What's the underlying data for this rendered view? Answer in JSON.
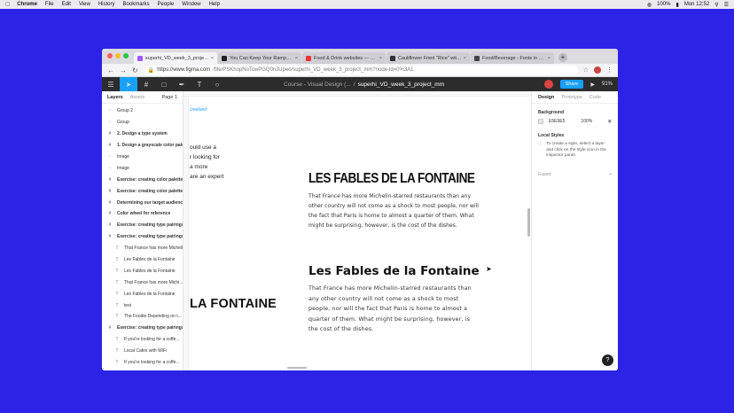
{
  "menubar": {
    "apple": "",
    "items": [
      "Chrome",
      "File",
      "Edit",
      "View",
      "History",
      "Bookmarks",
      "People",
      "Window",
      "Help"
    ],
    "battery": "100%",
    "clock": "Mon 12:52"
  },
  "browser": {
    "tabs": [
      {
        "title": "superhi_VD_week_3_project_mm",
        "color": "#a259ff",
        "active": true
      },
      {
        "title": "You Can Keep Your Ramps, Fr...",
        "color": "#222222",
        "active": false
      },
      {
        "title": "Food & Drink websites — alsc",
        "color": "#e33333",
        "active": false
      },
      {
        "title": "Cauliflower Fried \"Rice\" with C",
        "color": "#333333",
        "active": false
      },
      {
        "title": "Food/Beverage - Fonts in Use",
        "color": "#444444",
        "active": false
      }
    ],
    "new_tab": "+",
    "url_host": "https://www.figma.com",
    "url_path": "/file/PSKhopNoTcwPGQ0nJUpeo/superhi_VD_week_3_project_mm?node-id=0%3A1"
  },
  "figma": {
    "doc_parent": "Course - Visual Design (...",
    "doc_sep": "/",
    "doc_name": "superhi_VD_week_3_project_mm",
    "share_label": "Share",
    "zoom": "91%",
    "panels": {
      "layers_tab": "Layers",
      "assets_tab": "Assets",
      "page": "Page 1",
      "design_tab": "Design",
      "prototype_tab": "Prototype",
      "code_tab": "Code"
    },
    "layers": [
      {
        "label": "Group 2",
        "icon": "▫",
        "bold": false,
        "indent": 0
      },
      {
        "label": "Group",
        "icon": "▫",
        "bold": false,
        "indent": 0
      },
      {
        "label": "2. Design a type system",
        "icon": "#",
        "bold": true,
        "indent": 0
      },
      {
        "label": "1. Design a grayscale color pale...",
        "icon": "#",
        "bold": true,
        "indent": 0
      },
      {
        "label": "Image",
        "icon": "▫",
        "bold": false,
        "indent": 0
      },
      {
        "label": "Image",
        "icon": "▫",
        "bold": false,
        "indent": 0
      },
      {
        "label": "Exercise: creating color palettes",
        "icon": "#",
        "bold": true,
        "indent": 0
      },
      {
        "label": "Exercise: creating color palettes",
        "icon": "#",
        "bold": true,
        "indent": 0
      },
      {
        "label": "Determining our target audience",
        "icon": "#",
        "bold": true,
        "indent": 0
      },
      {
        "label": "Color wheel for reference",
        "icon": "#",
        "bold": true,
        "indent": 0
      },
      {
        "label": "Exercise: creating type pairings",
        "icon": "#",
        "bold": true,
        "indent": 0
      },
      {
        "label": "Exercise: creating type pairings",
        "icon": "#",
        "bold": true,
        "indent": 0
      },
      {
        "label": "That France has more Michelin...",
        "icon": "T",
        "bold": false,
        "indent": 1
      },
      {
        "label": "Les Fables de la Fontaine",
        "icon": "T",
        "bold": false,
        "indent": 1
      },
      {
        "label": "Les Fables de la Fontaine",
        "icon": "T",
        "bold": false,
        "indent": 1
      },
      {
        "label": "That France has more Michi...",
        "icon": "T",
        "bold": false,
        "indent": 1
      },
      {
        "label": "Les Fables de la Fontaine",
        "icon": "T",
        "bold": false,
        "indent": 1
      },
      {
        "label": "text",
        "icon": "T",
        "bold": false,
        "indent": 1
      },
      {
        "label": "The Foodie Depending on t...",
        "icon": "T",
        "bold": false,
        "indent": 1
      },
      {
        "label": "Exercise: creating type pairings",
        "icon": "#",
        "bold": true,
        "indent": 0
      },
      {
        "label": "If you're looking for a coffe...",
        "icon": "T",
        "bold": false,
        "indent": 1
      },
      {
        "label": "Local Cafes with WiFi",
        "icon": "T",
        "bold": false,
        "indent": 1
      },
      {
        "label": "If you're looking for a coffe...",
        "icon": "T",
        "bold": false,
        "indent": 1
      }
    ],
    "design_panel": {
      "background_title": "Background",
      "bg_color": "E5E5E5",
      "bg_opacity": "100%",
      "local_styles_title": "Local Styles",
      "local_styles_hint": "To create a style, select a layer and click on the style icon in the inspector panel.",
      "export_title": "Export",
      "export_add": "+"
    },
    "canvas": {
      "frame_label": "creeland",
      "fragment_lines": [
        "ould use a",
        "r looking for",
        "a more",
        " are an expert"
      ],
      "big_fragment": "LA FONTAINE",
      "heading1": "LES FABLES DE LA FONTAINE",
      "paragraph1": "That France has more Michelin-starred restaurants than any other country will not come as a shock to most people, nor will the fact that Paris is home to almost a quarter of them. What might be surprising, however, is the cost of the dishes.",
      "heading2": "Les Fables de la Fontaine",
      "paragraph2": "That France has more Michelin-starred restaurants than any other country will not come as a shock to most people, nor will the fact that Paris is home to almost a quarter of them. What might be surprising, however, is the cost of the dishes."
    },
    "help": "?"
  }
}
